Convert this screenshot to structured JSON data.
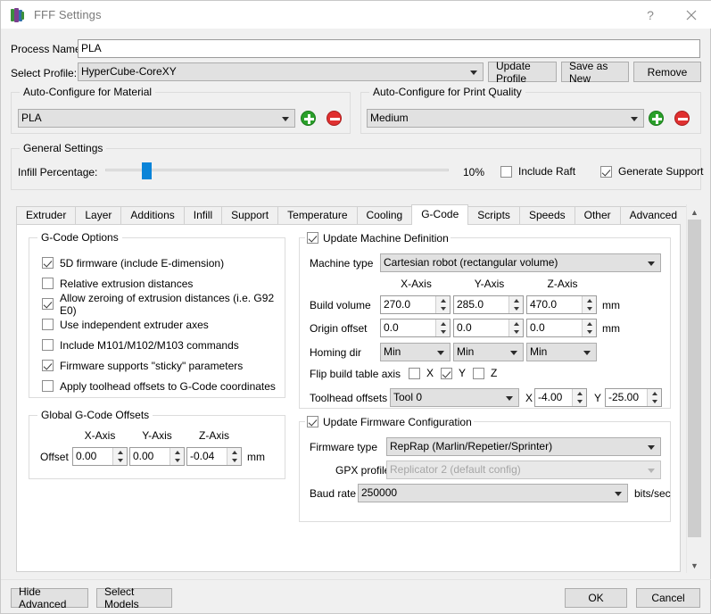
{
  "window": {
    "title": "FFF Settings",
    "icon": "app-icon",
    "help_label": "?",
    "close_label": "✕"
  },
  "header": {
    "process_name_label": "Process Name:",
    "process_name_value": "PLA",
    "select_profile_label": "Select Profile:",
    "select_profile_value": "HyperCube-CoreXY",
    "update_profile_label": "Update Profile",
    "save_as_new_label": "Save as New",
    "remove_label": "Remove"
  },
  "material_group": {
    "title": "Auto-Configure for Material",
    "value": "PLA",
    "add_label": "+",
    "remove_label": "-"
  },
  "quality_group": {
    "title": "Auto-Configure for Print Quality",
    "value": "Medium",
    "add_label": "+",
    "remove_label": "-"
  },
  "general_settings": {
    "title": "General Settings",
    "infill_label": "Infill Percentage:",
    "infill_value": "10%",
    "infill_percent": 10,
    "include_raft_label": "Include Raft",
    "include_raft_checked": false,
    "generate_support_label": "Generate Support",
    "generate_support_checked": true
  },
  "tabs": [
    {
      "label": "Extruder",
      "active": false
    },
    {
      "label": "Layer",
      "active": false
    },
    {
      "label": "Additions",
      "active": false
    },
    {
      "label": "Infill",
      "active": false
    },
    {
      "label": "Support",
      "active": false
    },
    {
      "label": "Temperature",
      "active": false
    },
    {
      "label": "Cooling",
      "active": false
    },
    {
      "label": "G-Code",
      "active": true
    },
    {
      "label": "Scripts",
      "active": false
    },
    {
      "label": "Speeds",
      "active": false
    },
    {
      "label": "Other",
      "active": false
    },
    {
      "label": "Advanced",
      "active": false
    }
  ],
  "gcode_options": {
    "title": "G-Code Options",
    "items": [
      {
        "label": "5D firmware (include E-dimension)",
        "checked": true
      },
      {
        "label": "Relative extrusion distances",
        "checked": false
      },
      {
        "label": "Allow zeroing of extrusion distances (i.e. G92 E0)",
        "checked": true
      },
      {
        "label": "Use independent extruder axes",
        "checked": false
      },
      {
        "label": "Include M101/M102/M103 commands",
        "checked": false
      },
      {
        "label": "Firmware supports \"sticky\" parameters",
        "checked": true
      },
      {
        "label": "Apply toolhead offsets to G-Code coordinates",
        "checked": false
      }
    ]
  },
  "global_offsets": {
    "title": "Global G-Code Offsets",
    "x_axis_header": "X-Axis",
    "y_axis_header": "Y-Axis",
    "z_axis_header": "Z-Axis",
    "offset_label": "Offset",
    "x_value": "0.00",
    "y_value": "0.00",
    "z_value": "-0.04",
    "units": "mm"
  },
  "machine_definition": {
    "title": "Update Machine Definition",
    "checked": true,
    "machine_type_label": "Machine type",
    "machine_type_value": "Cartesian robot (rectangular volume)",
    "x_axis_header": "X-Axis",
    "y_axis_header": "Y-Axis",
    "z_axis_header": "Z-Axis",
    "build_volume_label": "Build volume",
    "build_volume_x": "270.0",
    "build_volume_y": "285.0",
    "build_volume_z": "470.0",
    "build_volume_units": "mm",
    "origin_offset_label": "Origin offset",
    "origin_offset_x": "0.0",
    "origin_offset_y": "0.0",
    "origin_offset_z": "0.0",
    "origin_offset_units": "mm",
    "homing_dir_label": "Homing dir",
    "homing_dir_x": "Min",
    "homing_dir_y": "Min",
    "homing_dir_z": "Min",
    "flip_label": "Flip build table axis",
    "flip_x_label": "X",
    "flip_x_checked": false,
    "flip_y_label": "Y",
    "flip_y_checked": true,
    "flip_z_label": "Z",
    "flip_z_checked": false,
    "toolhead_offsets_label": "Toolhead offsets",
    "toolhead_tool_value": "Tool 0",
    "toolhead_x_label": "X",
    "toolhead_x_value": "-4.00",
    "toolhead_y_label": "Y",
    "toolhead_y_value": "-25.00"
  },
  "firmware_config": {
    "title": "Update Firmware Configuration",
    "checked": true,
    "firmware_type_label": "Firmware type",
    "firmware_type_value": "RepRap (Marlin/Repetier/Sprinter)",
    "gpx_profile_label": "GPX profile",
    "gpx_profile_value": "Replicator 2 (default config)",
    "gpx_profile_disabled": true,
    "baud_rate_label": "Baud rate",
    "baud_rate_value": "250000",
    "baud_rate_units": "bits/sec"
  },
  "footer": {
    "hide_advanced_label": "Hide Advanced",
    "select_models_label": "Select Models",
    "ok_label": "OK",
    "cancel_label": "Cancel"
  },
  "colors": {
    "window_bg": "#f0f0f0",
    "panel_bg": "#ffffff",
    "accent_blue": "#0a84d8",
    "add_green": "#2aa02a",
    "remove_red": "#e03030",
    "border": "#dcdcdc"
  }
}
